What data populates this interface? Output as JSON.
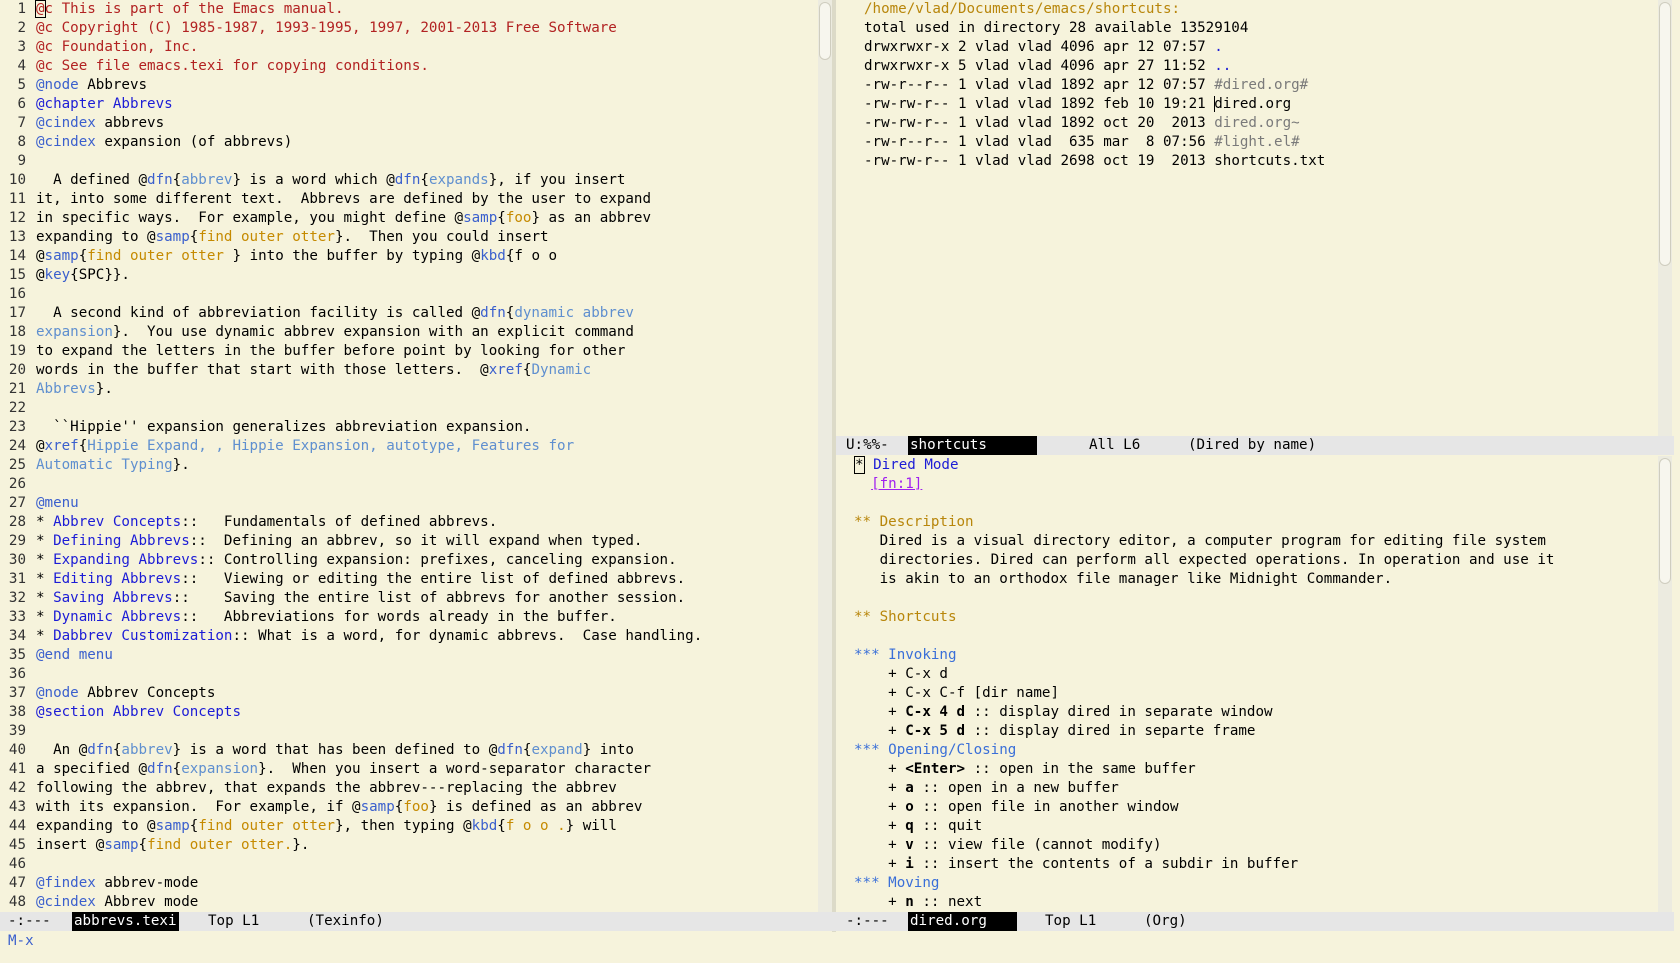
{
  "left": {
    "lines": [
      [
        [
          "c",
          "@"
        ],
        [
          "c",
          "c This is part of the Emacs manual."
        ]
      ],
      [
        [
          "c",
          "@c Copyright (C) 1985-1987, 1993-1995, 1997, 2001-2013 Free Software"
        ]
      ],
      [
        [
          "c",
          "@c Foundation, Inc."
        ]
      ],
      [
        [
          "c",
          "@c See file emacs.texi for copying conditions."
        ]
      ],
      [
        [
          "k",
          "@node"
        ],
        [
          "n",
          " Abbrevs"
        ]
      ],
      [
        [
          "l",
          "@chapter Abbrevs"
        ]
      ],
      [
        [
          "k",
          "@cindex"
        ],
        [
          "n",
          " abbrevs"
        ]
      ],
      [
        [
          "k",
          "@cindex"
        ],
        [
          "n",
          " expansion (of abbrevs)"
        ]
      ],
      [],
      [
        [
          "n",
          "  A defined @"
        ],
        [
          "k",
          "dfn"
        ],
        [
          "n",
          "{"
        ],
        [
          "a",
          "abbrev"
        ],
        [
          "n",
          "} is a word which @"
        ],
        [
          "k",
          "dfn"
        ],
        [
          "n",
          "{"
        ],
        [
          "a",
          "expands"
        ],
        [
          "n",
          "}, if you insert"
        ]
      ],
      [
        [
          "n",
          "it, into some different text.  Abbrevs are defined by the user to expand"
        ]
      ],
      [
        [
          "n",
          "in specific ways.  For example, you might define @"
        ],
        [
          "k",
          "samp"
        ],
        [
          "n",
          "{"
        ],
        [
          "s",
          "foo"
        ],
        [
          "n",
          "} as an abbrev"
        ]
      ],
      [
        [
          "n",
          "expanding to @"
        ],
        [
          "k",
          "samp"
        ],
        [
          "n",
          "{"
        ],
        [
          "s",
          "find outer otter"
        ],
        [
          "n",
          "}.  Then you could insert"
        ]
      ],
      [
        [
          "n",
          "@"
        ],
        [
          "k",
          "samp"
        ],
        [
          "n",
          "{"
        ],
        [
          "s",
          "find outer otter "
        ],
        [
          "n",
          "} into the buffer by typing @"
        ],
        [
          "k",
          "kbd"
        ],
        [
          "n",
          "{f o o"
        ]
      ],
      [
        [
          "n",
          "@"
        ],
        [
          "k",
          "key"
        ],
        [
          "n",
          "{SPC}}."
        ]
      ],
      [],
      [
        [
          "n",
          "  A second kind of abbreviation facility is called @"
        ],
        [
          "k",
          "dfn"
        ],
        [
          "n",
          "{"
        ],
        [
          "a",
          "dynamic abbrev"
        ]
      ],
      [
        [
          "a",
          "expansion"
        ],
        [
          "n",
          "}.  You use dynamic abbrev expansion with an explicit command"
        ]
      ],
      [
        [
          "n",
          "to expand the letters in the buffer before point by looking for other"
        ]
      ],
      [
        [
          "n",
          "words in the buffer that start with those letters.  @"
        ],
        [
          "k",
          "xref"
        ],
        [
          "n",
          "{"
        ],
        [
          "a",
          "Dynamic"
        ]
      ],
      [
        [
          "a",
          "Abbrevs"
        ],
        [
          "n",
          "}."
        ]
      ],
      [],
      [
        [
          "n",
          "  ``Hippie'' expansion generalizes abbreviation expansion."
        ]
      ],
      [
        [
          "n",
          "@"
        ],
        [
          "k",
          "xref"
        ],
        [
          "n",
          "{"
        ],
        [
          "a",
          "Hippie Expand, , Hippie Expansion, autotype, Features for"
        ]
      ],
      [
        [
          "a",
          "Automatic Typing"
        ],
        [
          "n",
          "}."
        ]
      ],
      [],
      [
        [
          "k",
          "@menu"
        ]
      ],
      [
        [
          "n",
          "* "
        ],
        [
          "l",
          "Abbrev Concepts"
        ],
        [
          "n",
          "::   Fundamentals of defined abbrevs."
        ]
      ],
      [
        [
          "n",
          "* "
        ],
        [
          "l",
          "Defining Abbrevs"
        ],
        [
          "n",
          "::  Defining an abbrev, so it will expand when typed."
        ]
      ],
      [
        [
          "n",
          "* "
        ],
        [
          "l",
          "Expanding Abbrevs"
        ],
        [
          "n",
          ":: Controlling expansion: prefixes, canceling expansion."
        ]
      ],
      [
        [
          "n",
          "* "
        ],
        [
          "l",
          "Editing Abbrevs"
        ],
        [
          "n",
          "::   Viewing or editing the entire list of defined abbrevs."
        ]
      ],
      [
        [
          "n",
          "* "
        ],
        [
          "l",
          "Saving Abbrevs"
        ],
        [
          "n",
          "::    Saving the entire list of abbrevs for another session."
        ]
      ],
      [
        [
          "n",
          "* "
        ],
        [
          "l",
          "Dynamic Abbrevs"
        ],
        [
          "n",
          "::   Abbreviations for words already in the buffer."
        ]
      ],
      [
        [
          "n",
          "* "
        ],
        [
          "l",
          "Dabbrev Customization"
        ],
        [
          "n",
          ":: What is a word, for dynamic abbrevs.  Case handling."
        ]
      ],
      [
        [
          "k",
          "@end menu"
        ]
      ],
      [],
      [
        [
          "k",
          "@node"
        ],
        [
          "n",
          " Abbrev Concepts"
        ]
      ],
      [
        [
          "l",
          "@section Abbrev Concepts"
        ]
      ],
      [],
      [
        [
          "n",
          "  An @"
        ],
        [
          "k",
          "dfn"
        ],
        [
          "n",
          "{"
        ],
        [
          "a",
          "abbrev"
        ],
        [
          "n",
          "} is a word that has been defined to @"
        ],
        [
          "k",
          "dfn"
        ],
        [
          "n",
          "{"
        ],
        [
          "a",
          "expand"
        ],
        [
          "n",
          "} into"
        ]
      ],
      [
        [
          "n",
          "a specified @"
        ],
        [
          "k",
          "dfn"
        ],
        [
          "n",
          "{"
        ],
        [
          "a",
          "expansion"
        ],
        [
          "n",
          "}.  When you insert a word-separator character"
        ]
      ],
      [
        [
          "n",
          "following the abbrev, that expands the abbrev---replacing the abbrev"
        ]
      ],
      [
        [
          "n",
          "with its expansion.  For example, if @"
        ],
        [
          "k",
          "samp"
        ],
        [
          "n",
          "{"
        ],
        [
          "s",
          "foo"
        ],
        [
          "n",
          "} is defined as an abbrev"
        ]
      ],
      [
        [
          "n",
          "expanding to @"
        ],
        [
          "k",
          "samp"
        ],
        [
          "n",
          "{"
        ],
        [
          "s",
          "find outer otter"
        ],
        [
          "n",
          "}, then typing @"
        ],
        [
          "k",
          "kbd"
        ],
        [
          "n",
          "{"
        ],
        [
          "s",
          "f o o ."
        ],
        [
          "n",
          "} will"
        ]
      ],
      [
        [
          "n",
          "insert @"
        ],
        [
          "k",
          "samp"
        ],
        [
          "n",
          "{"
        ],
        [
          "s",
          "find outer otter."
        ],
        [
          "n",
          "}."
        ]
      ],
      [],
      [
        [
          "k",
          "@findex"
        ],
        [
          "n",
          " abbrev-mode"
        ]
      ],
      [
        [
          "k",
          "@cindex"
        ],
        [
          "n",
          " Abbrev mode"
        ]
      ]
    ],
    "line_numbers": [
      "1",
      "2",
      "3",
      "4",
      "5",
      "6",
      "7",
      "8",
      "9",
      "10",
      "11",
      "12",
      "13",
      "14",
      "15",
      "16",
      "17",
      "18",
      "19",
      "20",
      "21",
      "22",
      "23",
      "24",
      "25",
      "26",
      "27",
      "28",
      "29",
      "30",
      "31",
      "32",
      "33",
      "34",
      "35",
      "36",
      "37",
      "38",
      "39",
      "40",
      "41",
      "42",
      "43",
      "44",
      "45",
      "46",
      "47",
      "48"
    ],
    "modeline": {
      "status": "-:---",
      "buffer": "abbrevs.texi",
      "position": "Top L1",
      "mode": "(Texinfo)"
    }
  },
  "dired": {
    "header": "/home/vlad/Documents/emacs/shortcuts:",
    "total": "total used in directory 28 available 13529104",
    "entries": [
      {
        "perms": "drwxrwxr-x",
        "links": "2",
        "owner": "vlad",
        "group": "vlad",
        "size": "4096",
        "date": "apr 12 07:57",
        "name": ".",
        "kind": "dir"
      },
      {
        "perms": "drwxrwxr-x",
        "links": "5",
        "owner": "vlad",
        "group": "vlad",
        "size": "4096",
        "date": "apr 27 11:52",
        "name": "..",
        "kind": "dir"
      },
      {
        "perms": "-rw-r--r--",
        "links": "1",
        "owner": "vlad",
        "group": "vlad",
        "size": "1892",
        "date": "apr 12 07:57",
        "name": "#dired.org#",
        "kind": "temp"
      },
      {
        "perms": "-rw-rw-r--",
        "links": "1",
        "owner": "vlad",
        "group": "vlad",
        "size": "1892",
        "date": "feb 10 19:21",
        "name": "dired.org",
        "kind": "file"
      },
      {
        "perms": "-rw-rw-r--",
        "links": "1",
        "owner": "vlad",
        "group": "vlad",
        "size": "1892",
        "date": "oct 20  2013",
        "name": "dired.org~",
        "kind": "temp"
      },
      {
        "perms": "-rw-r--r--",
        "links": "1",
        "owner": "vlad",
        "group": "vlad",
        "size": " 635",
        "date": "mar  8 07:56",
        "name": "#light.el#",
        "kind": "temp"
      },
      {
        "perms": "-rw-rw-r--",
        "links": "1",
        "owner": "vlad",
        "group": "vlad",
        "size": "2698",
        "date": "oct 19  2013",
        "name": "shortcuts.txt",
        "kind": "file"
      }
    ],
    "modeline": {
      "status": "U:%%-",
      "buffer": "shortcuts",
      "position": "All L6",
      "mode": "(Dired by name)"
    }
  },
  "org": {
    "lines": [
      [
        [
          "cur",
          "*"
        ],
        [
          "h1",
          " Dired Mode"
        ]
      ],
      [
        [
          "n",
          "  "
        ],
        [
          "fn",
          "[fn:1]"
        ]
      ],
      [],
      [
        [
          "h2",
          "** Description"
        ]
      ],
      [
        [
          "n",
          "   Dired is a visual directory editor, a computer program for editing file system"
        ]
      ],
      [
        [
          "n",
          "   directories. Dired can perform all expected operations. In operation and use it"
        ]
      ],
      [
        [
          "n",
          "   is akin to an orthodox file manager like Midnight Commander."
        ]
      ],
      [],
      [
        [
          "h2",
          "** Shortcuts"
        ]
      ],
      [],
      [
        [
          "h3",
          "*** Invoking"
        ]
      ],
      [
        [
          "n",
          "    + C-x d"
        ]
      ],
      [
        [
          "n",
          "    + C-x C-f [dir name]"
        ]
      ],
      [
        [
          "n",
          "    + "
        ],
        [
          "b",
          "C-x 4 d"
        ],
        [
          "n",
          " :: display dired in separate window"
        ]
      ],
      [
        [
          "n",
          "    + "
        ],
        [
          "b",
          "C-x 5 d"
        ],
        [
          "n",
          " :: display dired in separte frame"
        ]
      ],
      [
        [
          "h3",
          "*** Opening/Closing"
        ]
      ],
      [
        [
          "n",
          "    + "
        ],
        [
          "b",
          "<Enter>"
        ],
        [
          "n",
          " :: open in the same buffer"
        ]
      ],
      [
        [
          "n",
          "    + "
        ],
        [
          "b",
          "a"
        ],
        [
          "n",
          " :: open in a new buffer"
        ]
      ],
      [
        [
          "n",
          "    + "
        ],
        [
          "b",
          "o"
        ],
        [
          "n",
          " :: open file in another window"
        ]
      ],
      [
        [
          "n",
          "    + "
        ],
        [
          "b",
          "q"
        ],
        [
          "n",
          " :: quit"
        ]
      ],
      [
        [
          "n",
          "    + "
        ],
        [
          "b",
          "v"
        ],
        [
          "n",
          " :: view file (cannot modify)"
        ]
      ],
      [
        [
          "n",
          "    + "
        ],
        [
          "b",
          "i"
        ],
        [
          "n",
          " :: insert the contents of a subdir in buffer"
        ]
      ],
      [
        [
          "h3",
          "*** Moving"
        ]
      ],
      [
        [
          "n",
          "    + "
        ],
        [
          "b",
          "n"
        ],
        [
          "n",
          " :: next"
        ]
      ]
    ],
    "modeline": {
      "status": "-:---",
      "buffer": "dired.org",
      "position": "Top L1",
      "mode": "(Org)"
    }
  },
  "minibuffer": {
    "prompt": "M-x"
  },
  "colors": {
    "background": "#f6f3dc",
    "comment": "#b22222",
    "keyword": "#3a5fcd",
    "argument": "#5f8fcf",
    "string": "#c58a00",
    "link": "#1c1cd6",
    "org_level2": "#b8860b",
    "org_level3": "#3a6fd8",
    "footnote": "#a020f0"
  }
}
